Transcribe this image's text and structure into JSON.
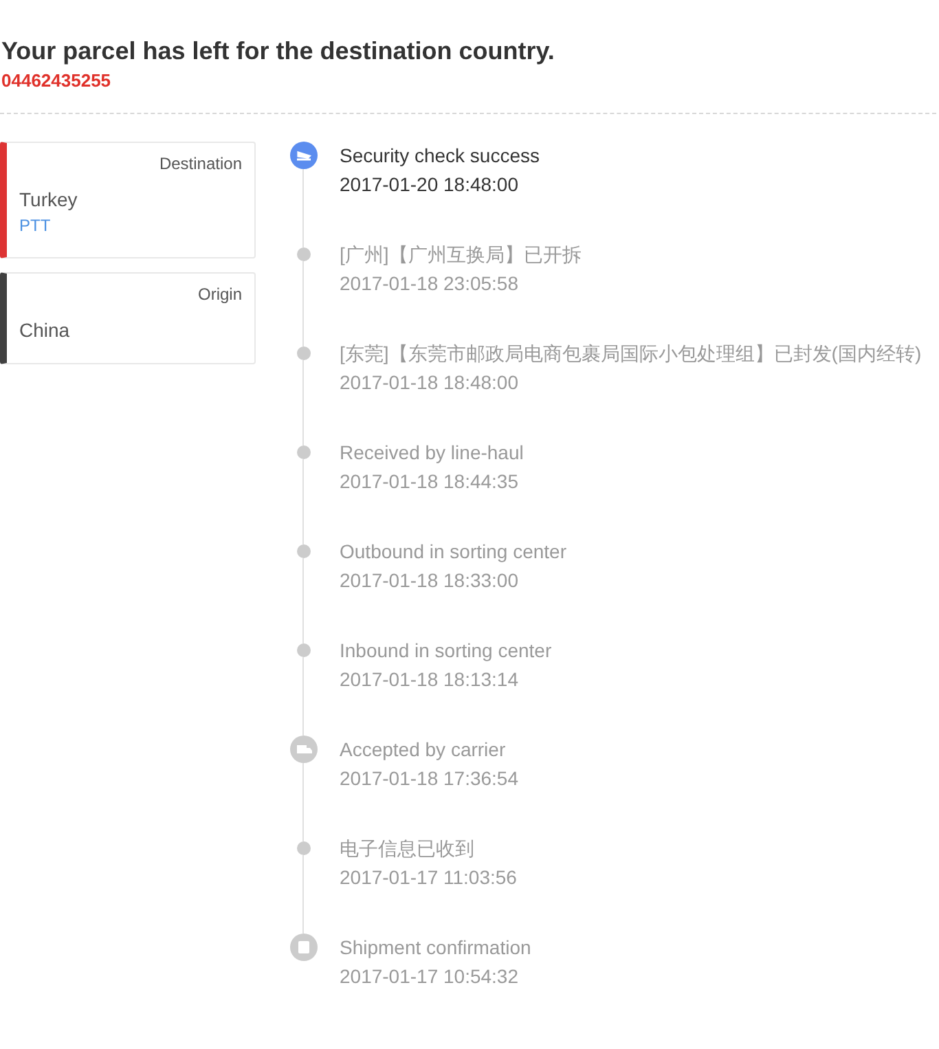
{
  "header": {
    "title": "Your parcel has left for the destination country.",
    "tracking_number": "04462435255"
  },
  "locations": [
    {
      "label": "Destination",
      "country": "Turkey",
      "carrier": "PTT",
      "color": "#dd3333"
    },
    {
      "label": "Origin",
      "country": "China",
      "color": "#404040"
    }
  ],
  "events": [
    {
      "kind": "plane",
      "current": true,
      "status": "Security check success",
      "time": "2017-01-20 18:48:00"
    },
    {
      "kind": "dot",
      "current": false,
      "status": "[广州]【广州互换局】已开拆",
      "time": "2017-01-18 23:05:58"
    },
    {
      "kind": "dot",
      "current": false,
      "status": "[东莞]【东莞市邮政局电商包裹局国际小包处理组】已封发(国内经转)",
      "time": "2017-01-18 18:48:00"
    },
    {
      "kind": "dot",
      "current": false,
      "status": "Received by line-haul",
      "time": "2017-01-18 18:44:35"
    },
    {
      "kind": "dot",
      "current": false,
      "status": "Outbound in sorting center",
      "time": "2017-01-18 18:33:00"
    },
    {
      "kind": "dot",
      "current": false,
      "status": "Inbound in sorting center",
      "time": "2017-01-18 18:13:14"
    },
    {
      "kind": "truck",
      "current": false,
      "status": "Accepted by carrier",
      "time": "2017-01-18 17:36:54"
    },
    {
      "kind": "dot",
      "current": false,
      "status": "电子信息已收到",
      "time": "2017-01-17 11:03:56"
    },
    {
      "kind": "box",
      "current": false,
      "status": "Shipment confirmation",
      "time": "2017-01-17 10:54:32"
    }
  ]
}
